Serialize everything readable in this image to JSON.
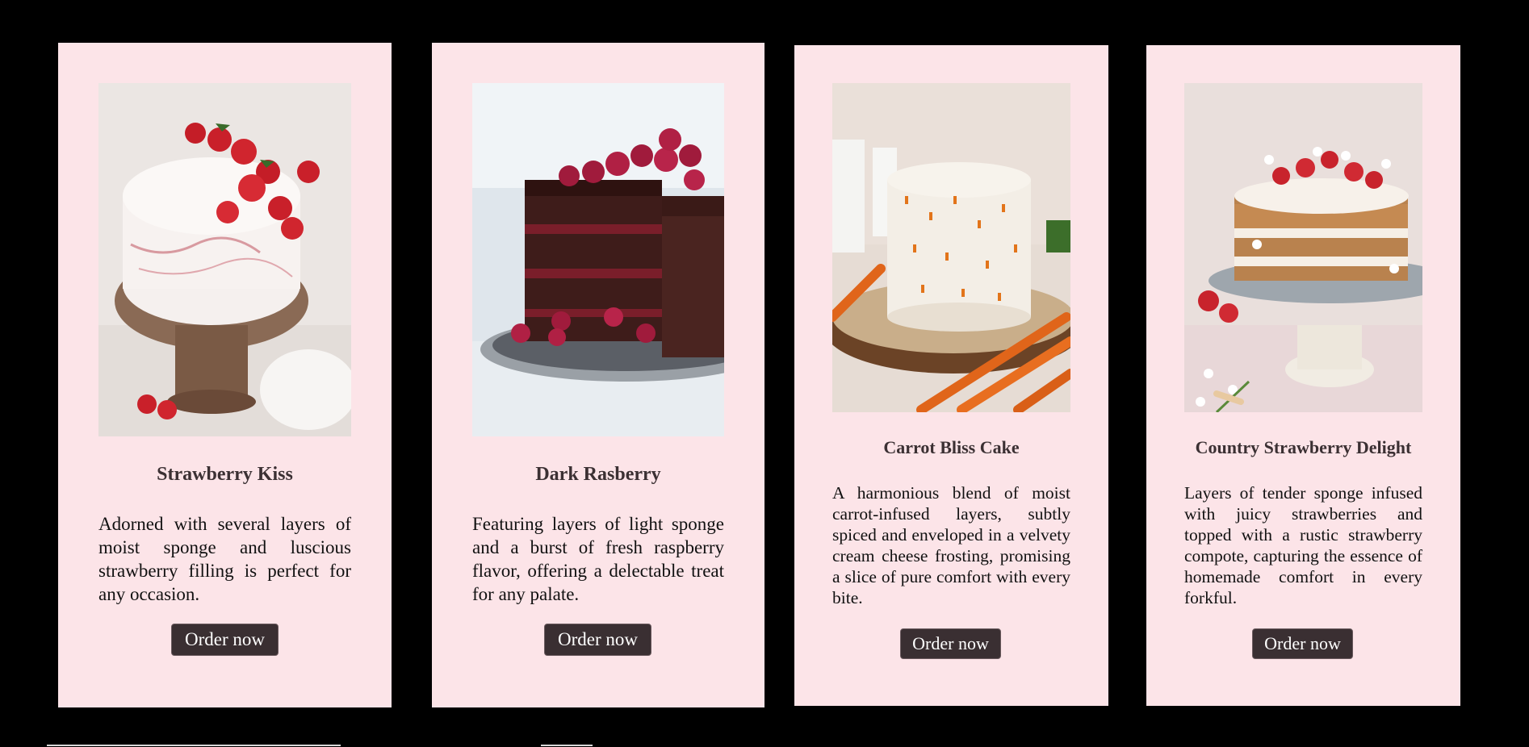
{
  "colors": {
    "page_background": "#000000",
    "card_background": "#fce4e8",
    "button_background": "#3a2f32",
    "button_text": "#ffffff",
    "title_text": "#3b3033"
  },
  "cards": [
    {
      "image_icon": "strawberry-cake-image",
      "title": "Strawberry Kiss",
      "description": "Adorned with several layers of moist sponge and luscious strawberry filling is perfect for any occasion.",
      "button_label": "Order now"
    },
    {
      "image_icon": "raspberry-chocolate-cake-image",
      "title": "Dark Rasberry",
      "description": "Featuring layers of light sponge and a burst of fresh raspberry flavor, offering a delectable treat for any palate.",
      "button_label": "Order now"
    },
    {
      "image_icon": "carrot-cake-image",
      "title": "Carrot Bliss Cake",
      "description": "A harmonious blend of moist carrot-infused layers, subtly spiced and enveloped in a velvety cream cheese frosting, promising a slice of pure comfort with every bite.",
      "button_label": "Order now"
    },
    {
      "image_icon": "naked-strawberry-cake-image",
      "title": "Country Strawberry Delight",
      "description": "Layers of tender sponge infused with juicy strawberries and topped with a rustic strawberry compote, capturing the essence of homemade comfort in every forkful.",
      "button_label": "Order now"
    }
  ]
}
